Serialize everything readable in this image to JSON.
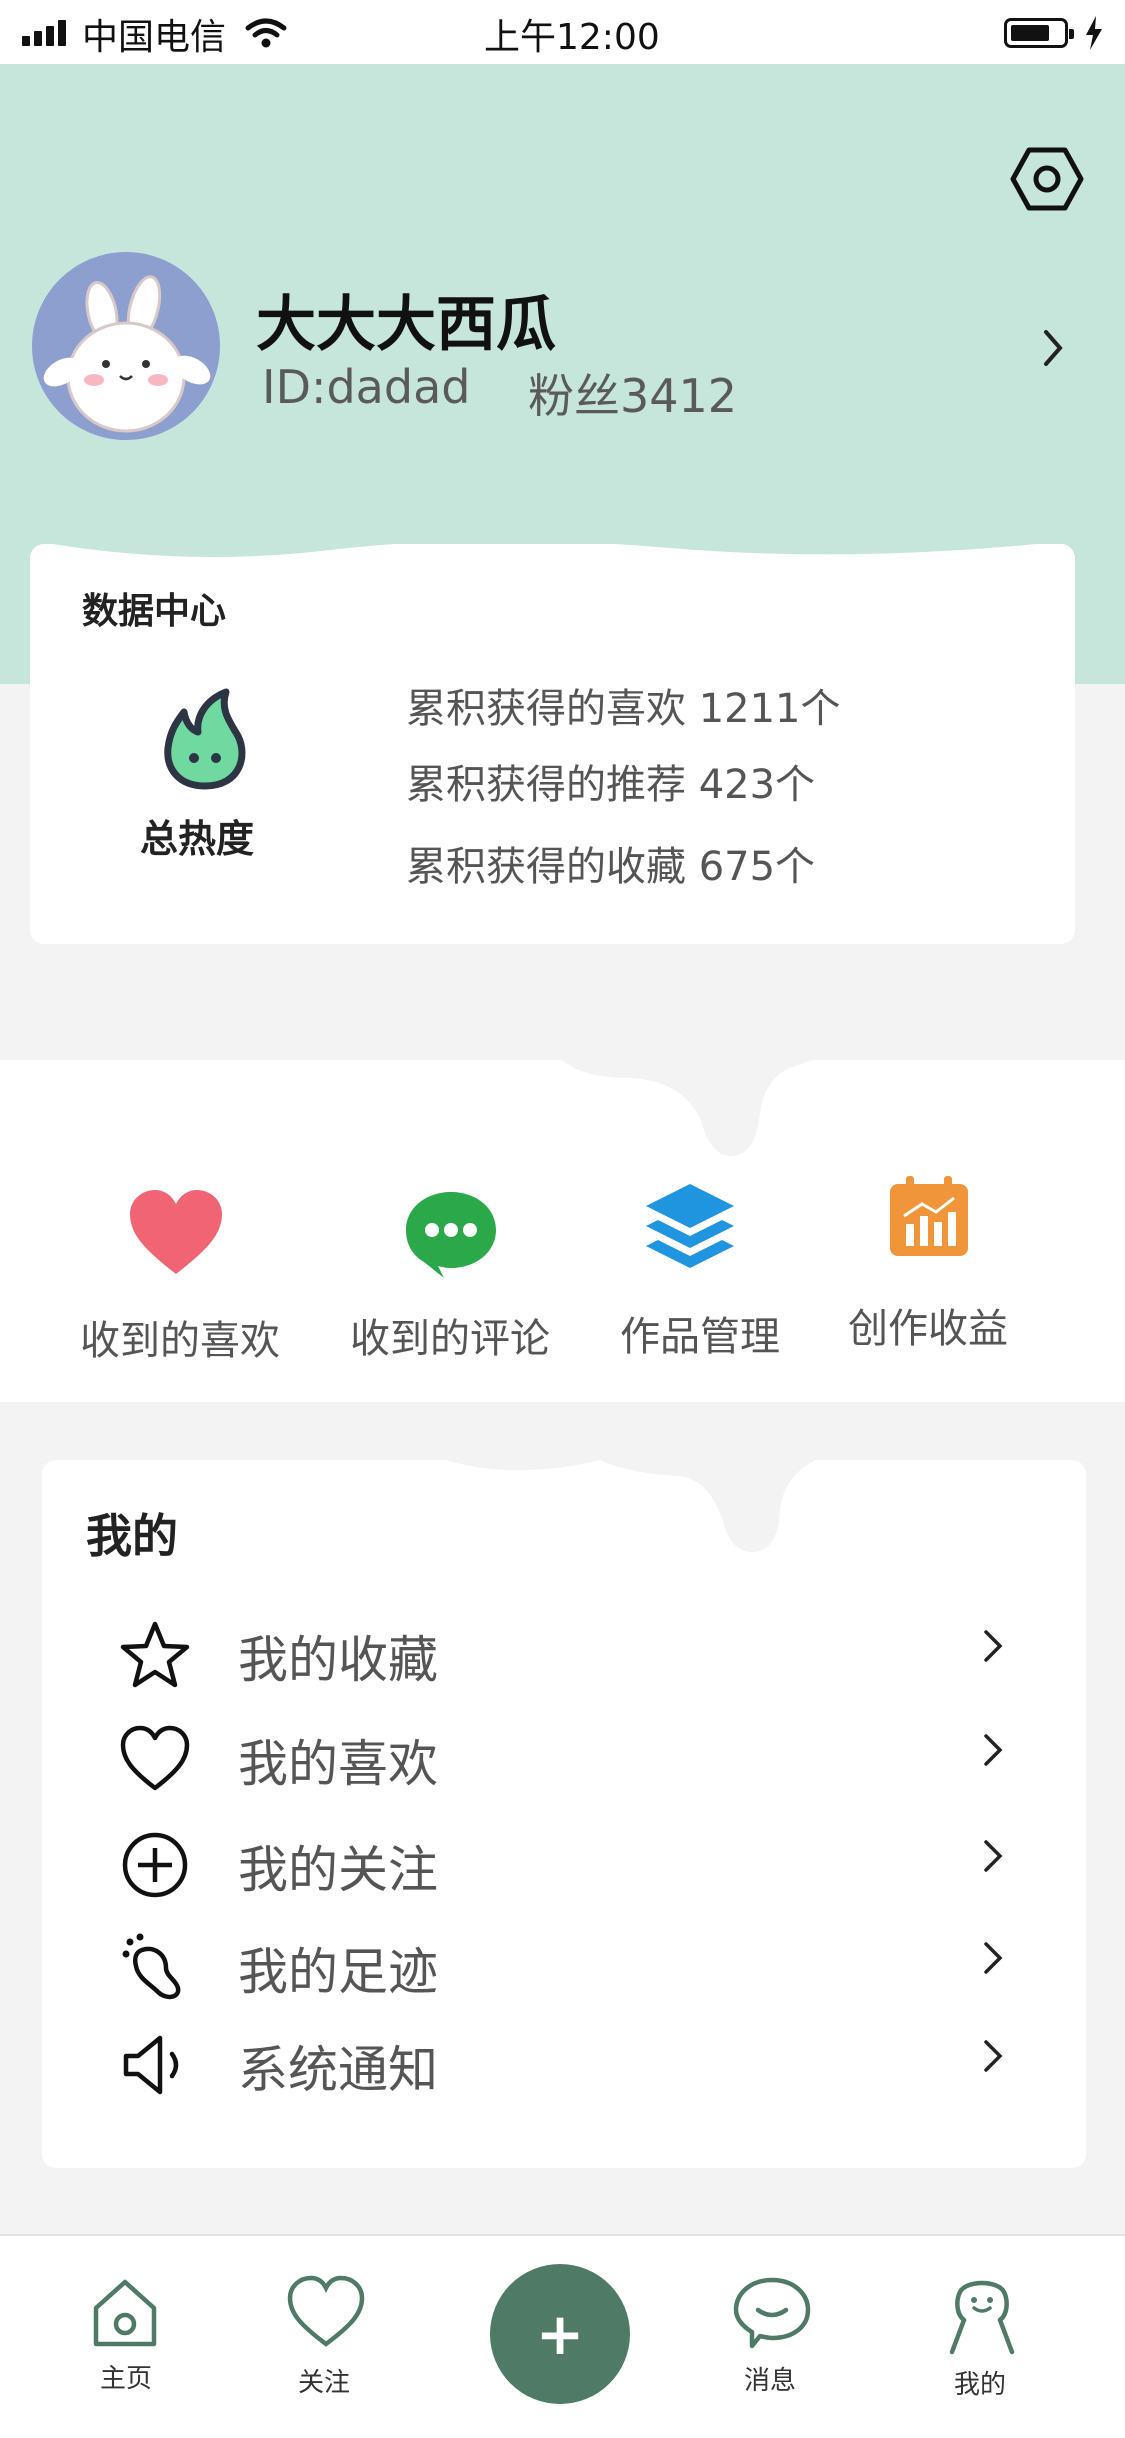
{
  "status_bar": {
    "carrier": "中国电信",
    "time": "上午12:00"
  },
  "profile": {
    "name": "大大大西瓜",
    "id_text": "ID:dadad",
    "fans_text": "粉丝3412"
  },
  "data_center": {
    "title": "数据中心",
    "hot_label": "总热度",
    "stats": [
      "累积获得的喜欢 1211个",
      "累积获得的推荐 423个",
      "累积获得的收藏 675个"
    ]
  },
  "actions": [
    {
      "label": "收到的喜欢",
      "icon": "heart-icon",
      "color": "#f06474"
    },
    {
      "label": "收到的评论",
      "icon": "chat-bubble-icon",
      "color": "#2aa84a"
    },
    {
      "label": "作品管理",
      "icon": "layers-icon",
      "color": "#1f95e0"
    },
    {
      "label": "创作收益",
      "icon": "calendar-chart-icon",
      "color": "#f0953a"
    }
  ],
  "my": {
    "title": "我的",
    "items": [
      {
        "label": "我的收藏",
        "icon": "star-icon"
      },
      {
        "label": "我的喜欢",
        "icon": "heart-outline-icon"
      },
      {
        "label": "我的关注",
        "icon": "plus-circle-icon"
      },
      {
        "label": "我的足迹",
        "icon": "footprint-icon"
      },
      {
        "label": "系统通知",
        "icon": "speaker-icon"
      }
    ]
  },
  "nav": {
    "home": "主页",
    "follow": "关注",
    "add": "+",
    "messages": "消息",
    "mine": "我的"
  },
  "colors": {
    "header_bg": "#c6e6dc",
    "accent": "#4e7a66",
    "fire": "#6fd9a0"
  }
}
